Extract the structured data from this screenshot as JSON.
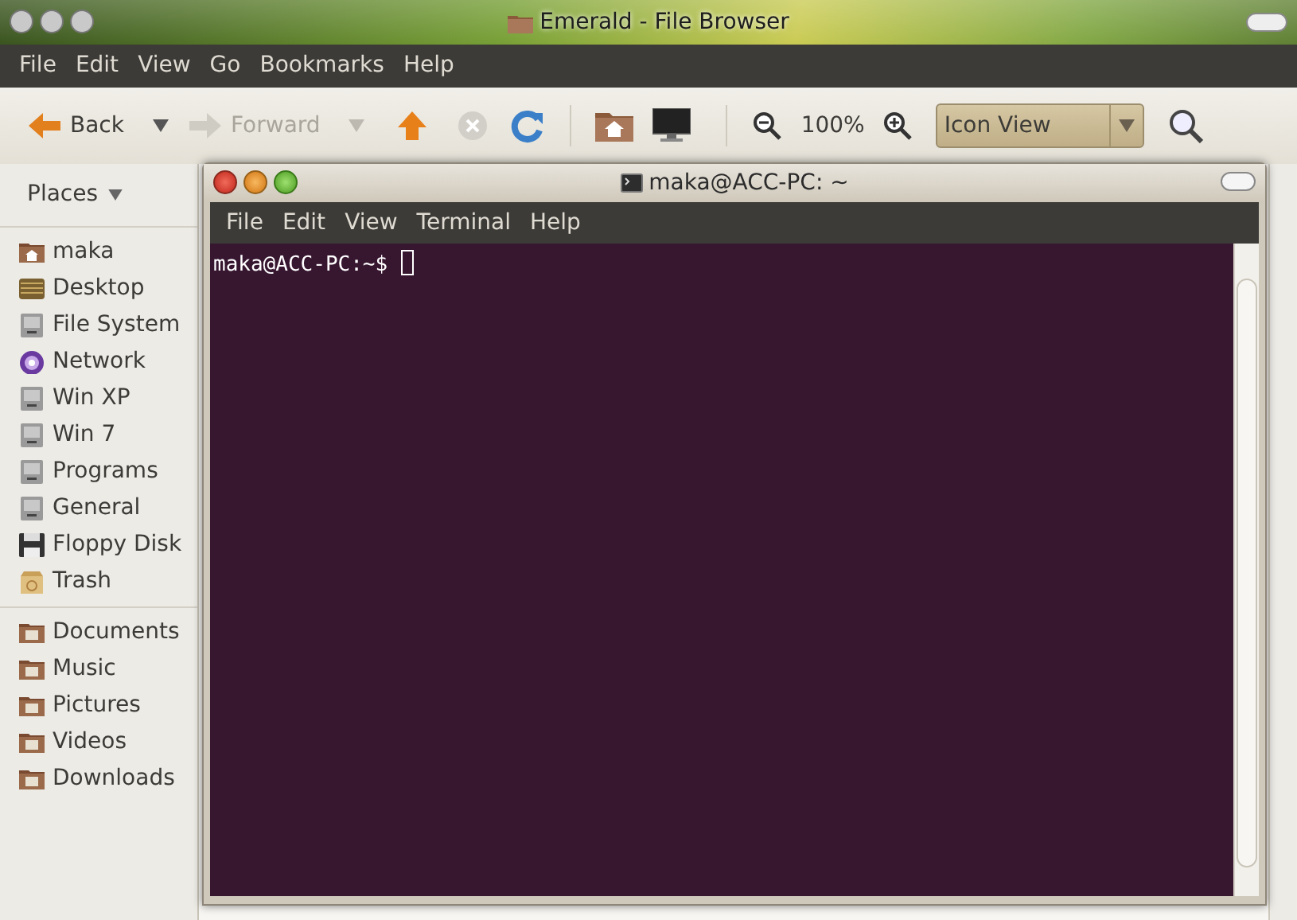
{
  "window": {
    "title": "Emerald - File Browser"
  },
  "menu": [
    "File",
    "Edit",
    "View",
    "Go",
    "Bookmarks",
    "Help"
  ],
  "toolbar": {
    "back": {
      "label": "Back",
      "disabled": false
    },
    "forward": {
      "label": "Forward",
      "disabled": true
    },
    "stop": {
      "disabled": true
    },
    "zoom_level": "100%",
    "view_select": {
      "value": "Icon View"
    }
  },
  "sidebar": {
    "header": "Places",
    "groups": [
      [
        {
          "label": "maka",
          "kind": "home"
        },
        {
          "label": "Desktop",
          "kind": "desktop"
        },
        {
          "label": "File System",
          "kind": "drive"
        },
        {
          "label": "Network",
          "kind": "network"
        },
        {
          "label": "Win XP",
          "kind": "drive"
        },
        {
          "label": "Win 7",
          "kind": "drive"
        },
        {
          "label": "Programs",
          "kind": "drive"
        },
        {
          "label": "General",
          "kind": "drive"
        },
        {
          "label": "Floppy Disk",
          "kind": "floppy"
        },
        {
          "label": "Trash",
          "kind": "trash"
        }
      ],
      [
        {
          "label": "Documents",
          "kind": "folder"
        },
        {
          "label": "Music",
          "kind": "folder"
        },
        {
          "label": "Pictures",
          "kind": "folder"
        },
        {
          "label": "Videos",
          "kind": "folder"
        },
        {
          "label": "Downloads",
          "kind": "folder"
        }
      ]
    ]
  },
  "terminal": {
    "title": "maka@ACC-PC: ~",
    "menu": [
      "File",
      "Edit",
      "View",
      "Terminal",
      "Help"
    ],
    "prompt": "maka@ACC-PC:~$"
  }
}
